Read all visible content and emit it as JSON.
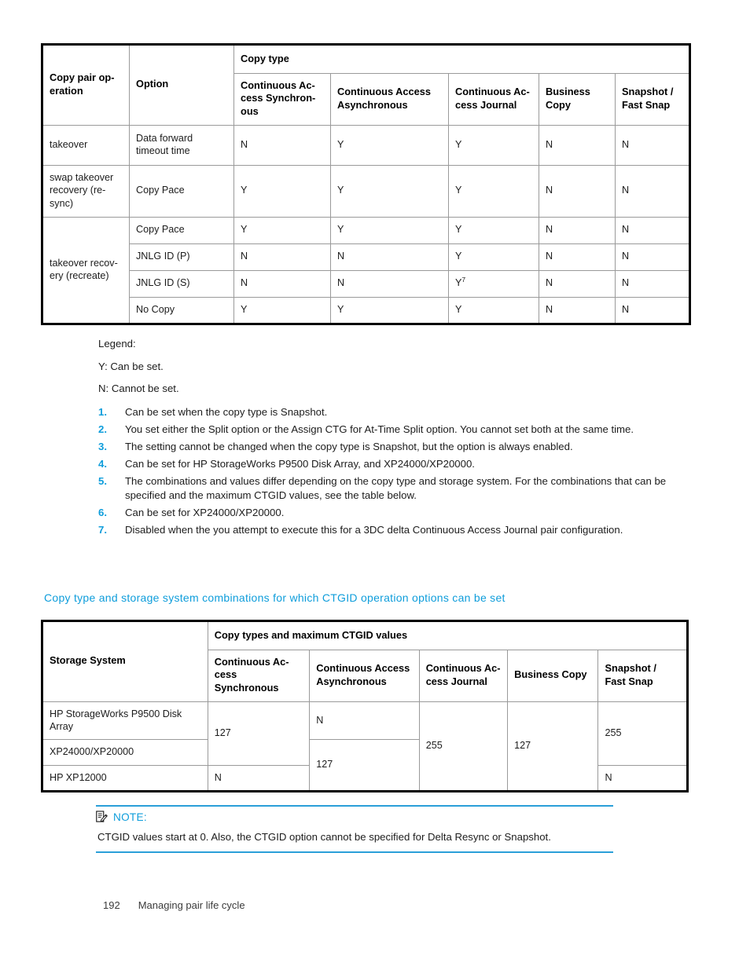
{
  "table1": {
    "name": "copy-pair-operation-options-table",
    "group_header": "Copy type",
    "headers": {
      "col1": "Copy pair op-\neration",
      "col2": "Option",
      "copy_types": [
        "Continuous Ac-\ncess Synchron-\nous",
        "Continuous Access\nAsynchronous",
        "Continuous Ac-\ncess Journal",
        "Business\nCopy",
        "Snapshot /\nFast Snap"
      ]
    },
    "rows": [
      {
        "operation": "takeover",
        "operation_rowspan": 1,
        "option": "Data forward\ntimeout time",
        "values": [
          "N",
          "Y",
          "Y",
          "N",
          "N"
        ]
      },
      {
        "operation": "swap takeover\nrecovery (re-\nsync)",
        "operation_rowspan": 1,
        "option": "Copy Pace",
        "values": [
          "Y",
          "Y",
          "Y",
          "N",
          "N"
        ]
      },
      {
        "operation": "takeover recov-\nery (recreate)",
        "operation_rowspan": 4,
        "option": "Copy Pace",
        "values": [
          "Y",
          "Y",
          "Y",
          "N",
          "N"
        ]
      },
      {
        "operation": "",
        "operation_rowspan": 0,
        "option": "JNLG ID (P)",
        "values": [
          "N",
          "N",
          "Y",
          "N",
          "N"
        ]
      },
      {
        "operation": "",
        "operation_rowspan": 0,
        "option": "JNLG ID (S)",
        "values": [
          "N",
          "N",
          "Y",
          "N",
          "N"
        ],
        "footnote_col": 2,
        "footnote_marker": "7"
      },
      {
        "operation": "",
        "operation_rowspan": 0,
        "option": "No Copy",
        "values": [
          "Y",
          "Y",
          "Y",
          "N",
          "N"
        ]
      }
    ]
  },
  "legend": {
    "title": "Legend:",
    "y_line": "Y: Can be set.",
    "n_line": "N: Cannot be set.",
    "notes": [
      "Can be set when the copy type is Snapshot.",
      "You set either the Split option or the Assign CTG for At-Time Split option. You cannot set both at the same time.",
      "The setting cannot be changed when the copy type is Snapshot, but the option is always enabled.",
      "Can be set for HP StorageWorks P9500 Disk Array, and XP24000/XP20000.",
      "The combinations and values differ depending on the copy type and storage system. For the combinations that can be specified and the maximum CTGID values, see the table below.",
      "Can be set for XP24000/XP20000.",
      "Disabled when the you attempt to execute this for a 3DC delta Continuous Access Journal pair configuration."
    ],
    "note_numbers": [
      "1.",
      "2.",
      "3.",
      "4.",
      "5.",
      "6.",
      "7."
    ]
  },
  "subheading": "Copy type and storage system combinations for which CTGID operation options can be set",
  "table2": {
    "name": "ctgid-storage-system-table",
    "group_header": "Copy types and maximum CTGID values",
    "headers": {
      "col1": "Storage System",
      "copy_types": [
        "Continuous Ac-\ncess Synchronous",
        "Continuous Access\nAsynchronous",
        "Continuous Ac-\ncess Journal",
        "Business Copy",
        "Snapshot /\nFast Snap"
      ]
    },
    "rows": [
      {
        "system": "HP StorageWorks P9500 Disk\nArray"
      },
      {
        "system": "XP24000/XP20000"
      },
      {
        "system": "HP XP12000"
      }
    ],
    "cells": {
      "sync_127": "127",
      "sync_n": "N",
      "async_n": "N",
      "async_127": "127",
      "journal_255": "255",
      "bc_127": "127",
      "snap_255": "255",
      "snap_n": "N"
    }
  },
  "note": {
    "icon": "note-pencil-icon",
    "title": "NOTE:",
    "body": "CTGID values start at 0. Also, the CTGID option cannot be specified for Delta Resync or Snapshot."
  },
  "footer": {
    "page_number": "192",
    "chapter": "Managing pair life cycle"
  },
  "colors": {
    "accent_blue": "#0e9ddb",
    "rule_blue": "#2a9fd8",
    "table_outer_border": "#000000",
    "table_inner_border": "#9a9a9a",
    "text": "#1c1c1c"
  }
}
